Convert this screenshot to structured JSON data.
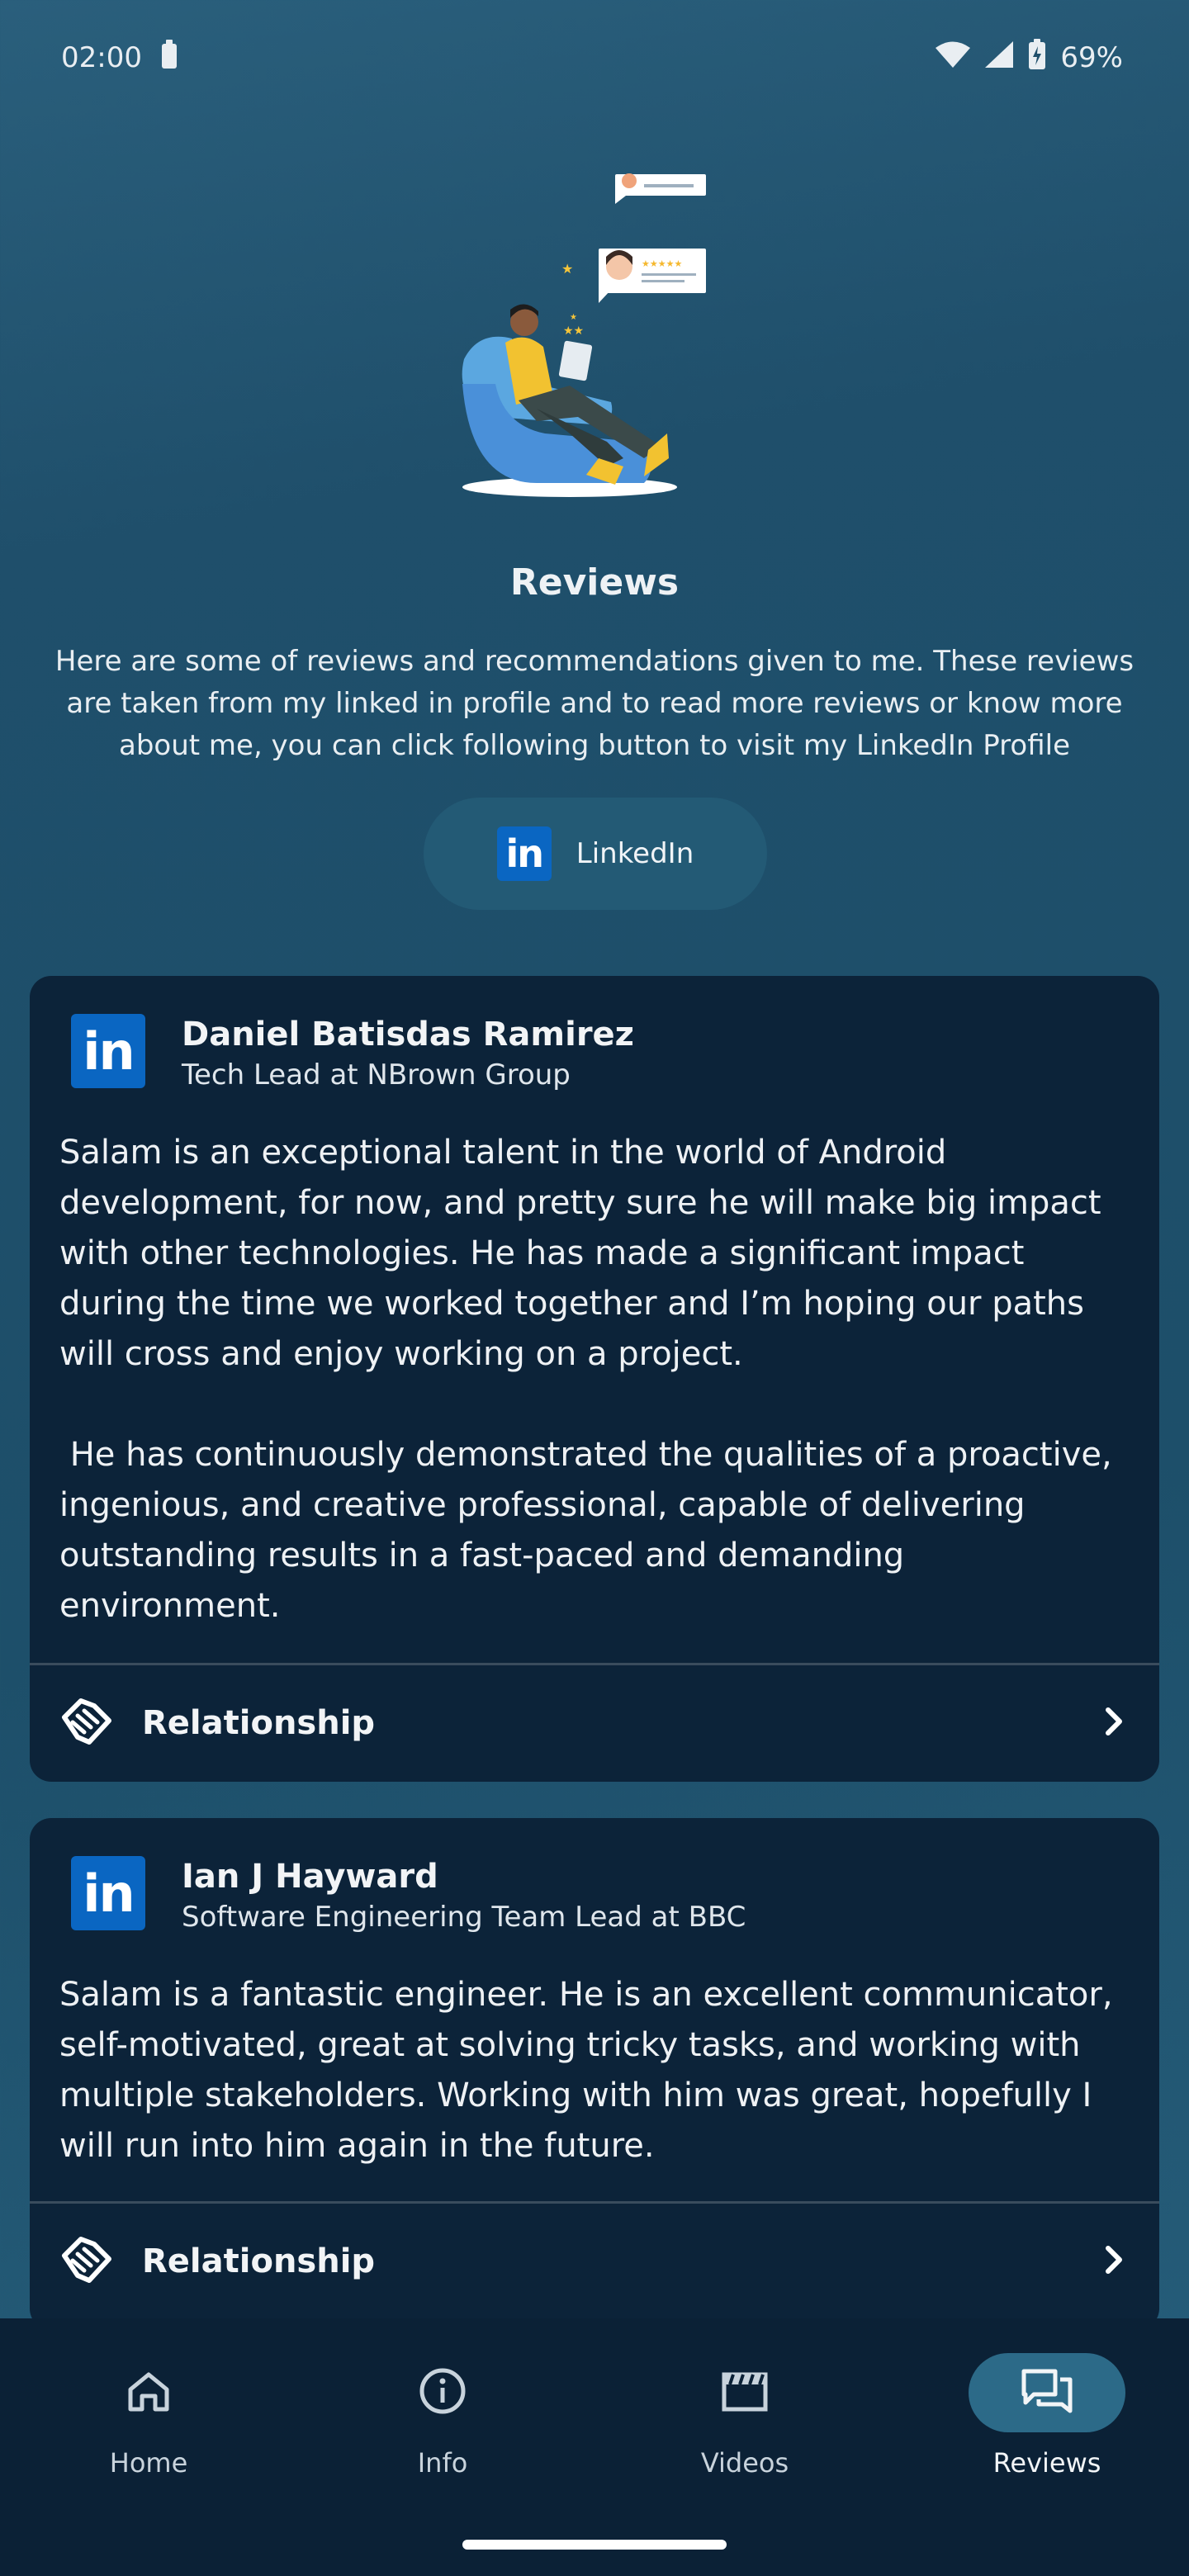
{
  "status_bar": {
    "time": "02:00",
    "battery": "69%"
  },
  "page": {
    "title": "Reviews",
    "intro": "Here are some of reviews and recommendations given to me. These reviews are taken from my linked in profile and to read more reviews or know more about me, you can click following button to visit my LinkedIn Profile",
    "linkedin_button_label": "LinkedIn",
    "linkedin_logo_text": "in"
  },
  "reviews": [
    {
      "name": "Daniel Batisdas Ramirez",
      "role": "Tech Lead at NBrown Group",
      "text": "Salam is an exceptional talent in the world of Android development, for now, and pretty sure he will make big impact with other technologies. He has made a significant impact during the time we worked together and I’m hoping our paths will cross and enjoy working on a project.\n\n He has continuously demonstrated the qualities of a proactive, ingenious, and creative professional, capable of delivering outstanding results in a fast-paced and demanding environment.",
      "relationship_label": "Relationship"
    },
    {
      "name": "Ian J Hayward",
      "role": "Software Engineering Team Lead at BBC",
      "text": "Salam is a fantastic engineer. He is an excellent communicator, self-motivated, great at solving tricky tasks, and working with multiple stakeholders. Working with him was great, hopefully I will run into him again in the future.",
      "relationship_label": "Relationship"
    }
  ],
  "bottom_nav": [
    {
      "label": "Home",
      "icon": "home-icon",
      "active": false
    },
    {
      "label": "Info",
      "icon": "info-icon",
      "active": false
    },
    {
      "label": "Videos",
      "icon": "videos-icon",
      "active": false
    },
    {
      "label": "Reviews",
      "icon": "reviews-icon",
      "active": true
    }
  ],
  "colors": {
    "background": "#1f4f6b",
    "card": "#0c2339",
    "nav_background": "#0b2136",
    "active_pill": "#2c6a88",
    "linkedin_blue": "#0a66c2"
  }
}
